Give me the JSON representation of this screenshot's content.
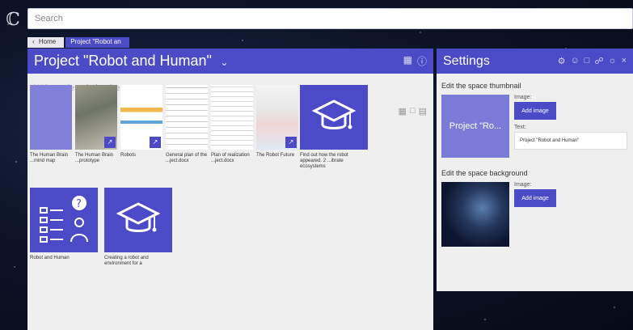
{
  "search": {
    "placeholder": "Search"
  },
  "breadcrumb": {
    "home": "Home",
    "current": "Project \"Robot an"
  },
  "main": {
    "title": "Project \"Robot and Human\"",
    "description_placeholder": "Write a description here",
    "add_label": "+"
  },
  "tiles": [
    {
      "label": "The Human Brain ...mind map"
    },
    {
      "label": "The Human Brain ...prototype"
    },
    {
      "label": "Robots"
    },
    {
      "label": "General plan of the ...ject.docx"
    },
    {
      "label": "Plan of realization ...ject.docx"
    },
    {
      "label": "The Robot Future"
    },
    {
      "label": "Find out how the robot appeared. 2 ...ibrate ecosystems"
    },
    {
      "label": "Robot and Human"
    },
    {
      "label": "Creating a robot and environment for a"
    }
  ],
  "settings": {
    "title": "Settings",
    "thumbnail_section": "Edit the space thumbnail",
    "thumbnail_preview": "Project \"Ro...",
    "image_label": "Image:",
    "add_image": "Add image",
    "text_label": "Text:",
    "text_value": "Project \"Robot and Human\"",
    "background_section": "Edit the space background",
    "bg_image_label": "Image:",
    "bg_add_image": "Add image"
  },
  "colors": {
    "accent": "#4b4bc8",
    "panel": "#efefef"
  }
}
